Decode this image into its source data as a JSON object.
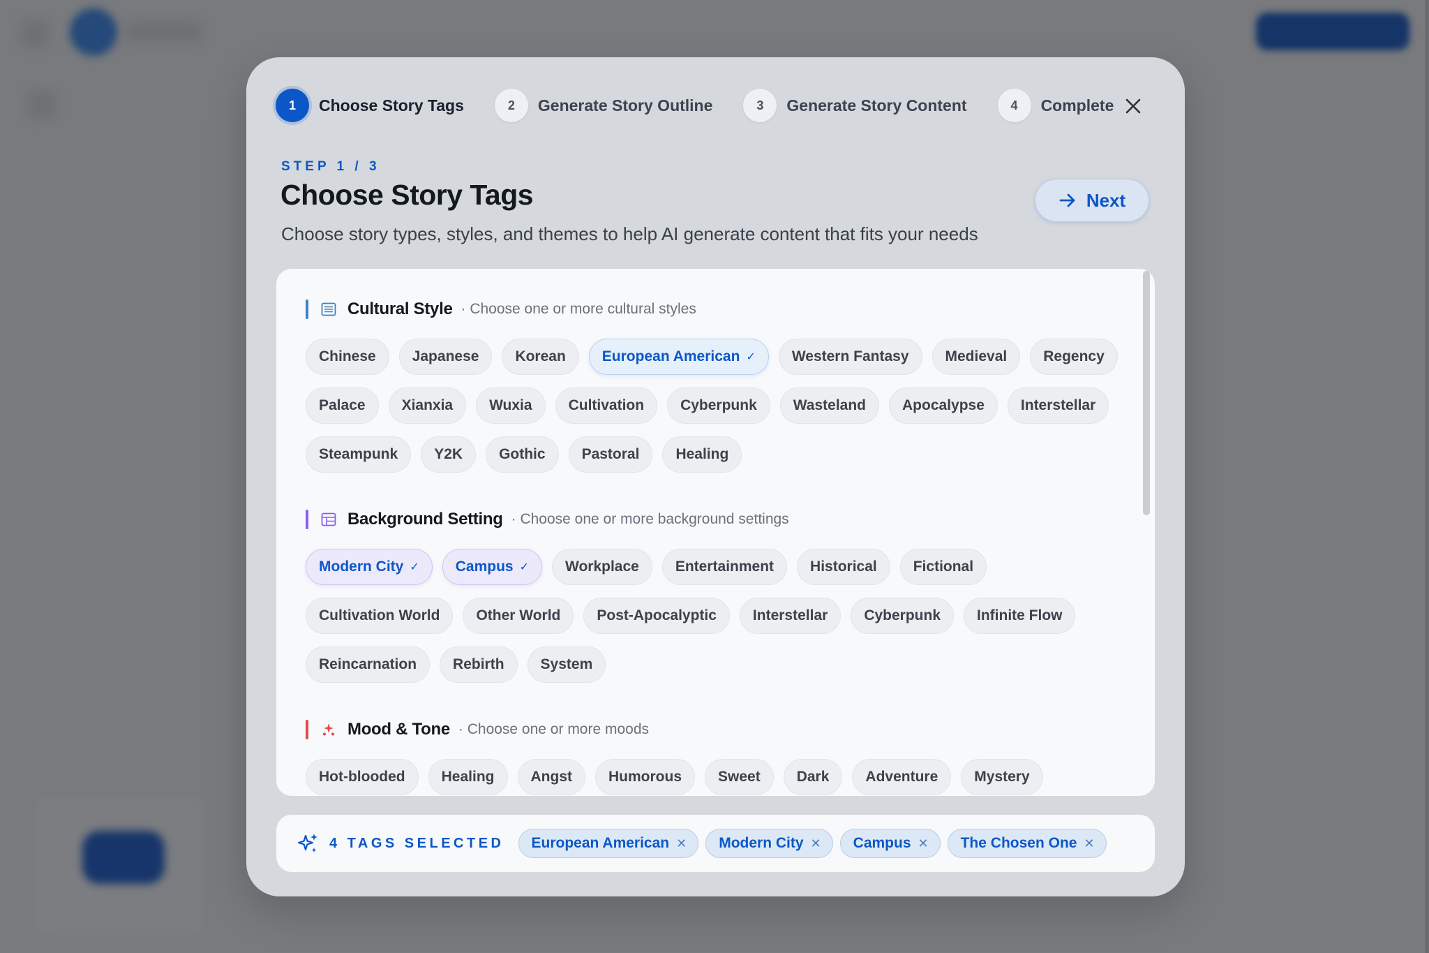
{
  "stepper": [
    {
      "num": "1",
      "label": "Choose Story Tags"
    },
    {
      "num": "2",
      "label": "Generate Story Outline"
    },
    {
      "num": "3",
      "label": "Generate Story Content"
    },
    {
      "num": "4",
      "label": "Complete"
    }
  ],
  "header": {
    "eyebrow": "STEP 1 / 3",
    "title": "Choose Story Tags",
    "description": "Choose story types, styles, and themes to help AI generate content that fits your needs",
    "next_label": "Next"
  },
  "sections": {
    "cultural": {
      "title": "Cultural Style",
      "hint": "· Choose one or more cultural styles",
      "accent": "#3b82c4",
      "tags": [
        "Chinese",
        "Japanese",
        "Korean",
        "European American",
        "Western Fantasy",
        "Medieval",
        "Regency",
        "Palace",
        "Xianxia",
        "Wuxia",
        "Cultivation",
        "Cyberpunk",
        "Wasteland",
        "Apocalypse",
        "Interstellar",
        "Steampunk",
        "Y2K",
        "Gothic",
        "Pastoral",
        "Healing"
      ]
    },
    "background": {
      "title": "Background Setting",
      "hint": "· Choose one or more background settings",
      "accent": "#8b5cf6",
      "tags": [
        "Modern City",
        "Campus",
        "Workplace",
        "Entertainment",
        "Historical",
        "Fictional",
        "Cultivation World",
        "Other World",
        "Post-Apocalyptic",
        "Interstellar",
        "Cyberpunk",
        "Infinite Flow",
        "Reincarnation",
        "Rebirth",
        "System"
      ]
    },
    "mood": {
      "title": "Mood & Tone",
      "hint": "· Choose one or more moods",
      "accent": "#e5484d",
      "tags": [
        "Hot-blooded",
        "Healing",
        "Angst",
        "Humorous",
        "Sweet",
        "Dark",
        "Adventure",
        "Mystery"
      ]
    }
  },
  "selected": {
    "label": "4 TAGS SELECTED",
    "tags": [
      "European American",
      "Modern City",
      "Campus",
      "The Chosen One"
    ]
  },
  "colors": {
    "accent_blue": "#0b57c7",
    "modal_bg": "#d5d8dc",
    "card_bg": "#f8f9fa"
  }
}
